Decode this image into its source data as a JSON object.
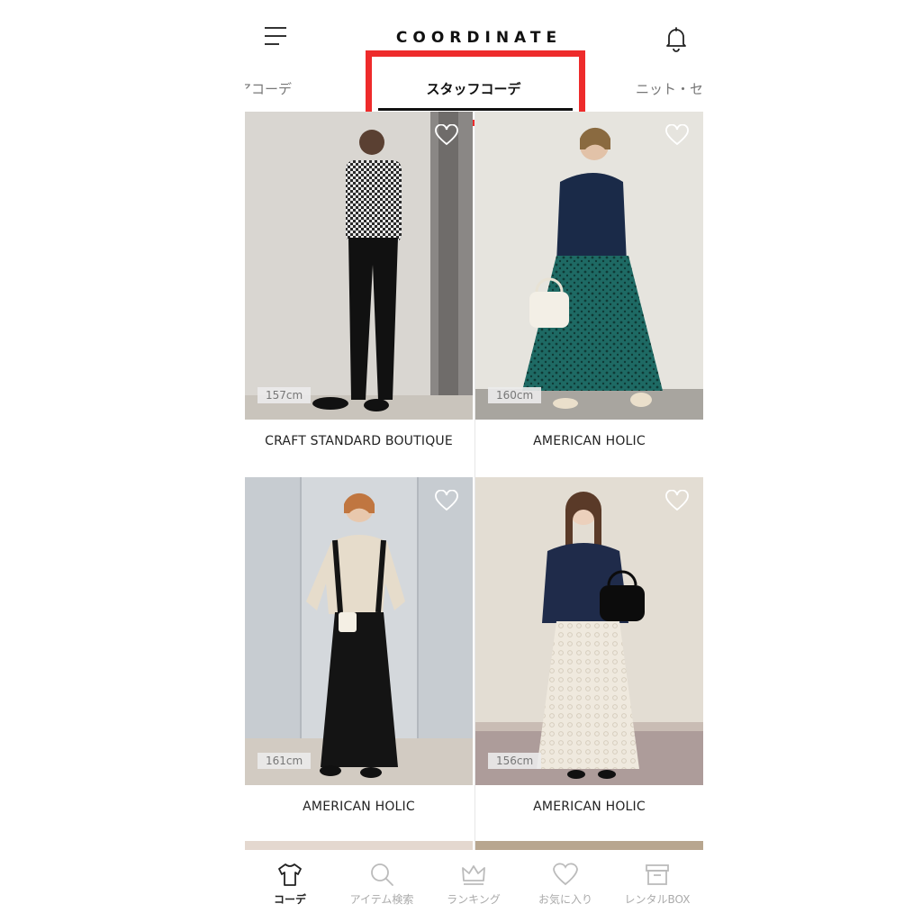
{
  "header": {
    "title": "COORDINATE",
    "menu_icon": "hamburger-menu-icon",
    "bell_icon": "bell-icon"
  },
  "tabs": [
    {
      "label": "アコーデ",
      "active": false
    },
    {
      "label": "スタッフコーデ",
      "active": true
    },
    {
      "label": "ニット・セ",
      "active": false
    }
  ],
  "accent": {
    "highlight": "#ee2b2b",
    "underline": "#111111"
  },
  "coordinates": [
    {
      "brand": "CRAFT STANDARD BOUTIQUE",
      "height": "157cm",
      "favorite": false
    },
    {
      "brand": "AMERICAN HOLIC",
      "height": "160cm",
      "favorite": false
    },
    {
      "brand": "AMERICAN HOLIC",
      "height": "161cm",
      "favorite": false
    },
    {
      "brand": "AMERICAN HOLIC",
      "height": "156cm",
      "favorite": false
    }
  ],
  "bottom_nav": [
    {
      "label": "コーデ",
      "icon": "tshirt-icon",
      "active": true
    },
    {
      "label": "アイテム検索",
      "icon": "search-icon",
      "active": false
    },
    {
      "label": "ランキング",
      "icon": "crown-icon",
      "active": false
    },
    {
      "label": "お気に入り",
      "icon": "heart-icon",
      "active": false
    },
    {
      "label": "レンタルBOX",
      "icon": "box-icon",
      "active": false
    }
  ]
}
